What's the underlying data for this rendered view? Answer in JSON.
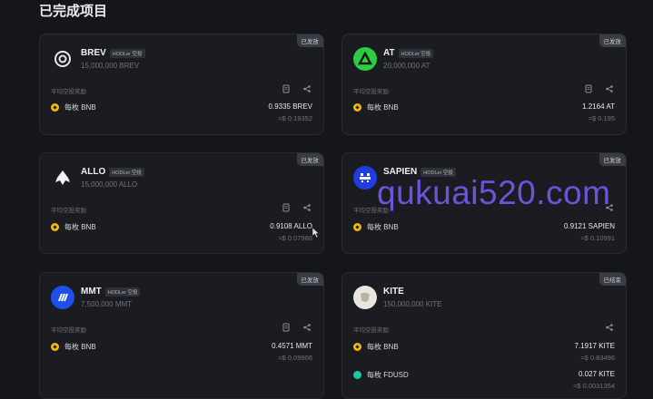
{
  "section_title": "已完成项目",
  "reward_label": "平均空投奖励",
  "badge": "HODLer 空投",
  "cards": [
    {
      "name": "BREV",
      "supply": "15,000,000 BREV",
      "status": "已发放",
      "rows": [
        {
          "token": "每枚 BNB",
          "amount": "0.9335 BREV",
          "usd": "≈$ 0.19352"
        }
      ]
    },
    {
      "name": "AT",
      "supply": "20,000,000 AT",
      "status": "已发放",
      "rows": [
        {
          "token": "每枚 BNB",
          "amount": "1.2164 AT",
          "usd": "≈$ 0.195"
        }
      ]
    },
    {
      "name": "ALLO",
      "supply": "15,000,000 ALLO",
      "status": "已发放",
      "rows": [
        {
          "token": "每枚 BNB",
          "amount": "0.9108 ALLO",
          "usd": "≈$ 0.07988"
        }
      ]
    },
    {
      "name": "SAPIEN",
      "supply": "",
      "status": "已发放",
      "rows": [
        {
          "token": "每枚 BNB",
          "amount": "0.9121 SAPIEN",
          "usd": "≈$ 0.10991"
        }
      ]
    },
    {
      "name": "MMT",
      "supply": "7,500,000 MMT",
      "status": "已发放",
      "rows": [
        {
          "token": "每枚 BNB",
          "amount": "0.4571 MMT",
          "usd": "≈$ 0.09906"
        }
      ]
    },
    {
      "name": "KITE",
      "supply": "150,000,000 KITE",
      "status": "已结束",
      "rows": [
        {
          "token": "每枚 BNB",
          "amount": "7.1917 KITE",
          "usd": "≈$ 0.83496"
        },
        {
          "token": "每枚 FDUSD",
          "amount": "0.027 KITE",
          "usd": "≈$ 0.0031354"
        }
      ]
    }
  ],
  "watermark": "qukuai520.com",
  "colors": {
    "background": "#15161b",
    "card": "#1b1c22",
    "bnb": "#f0b90b",
    "fdusd": "#1fc7a4",
    "watermark": "#6b54d9"
  }
}
